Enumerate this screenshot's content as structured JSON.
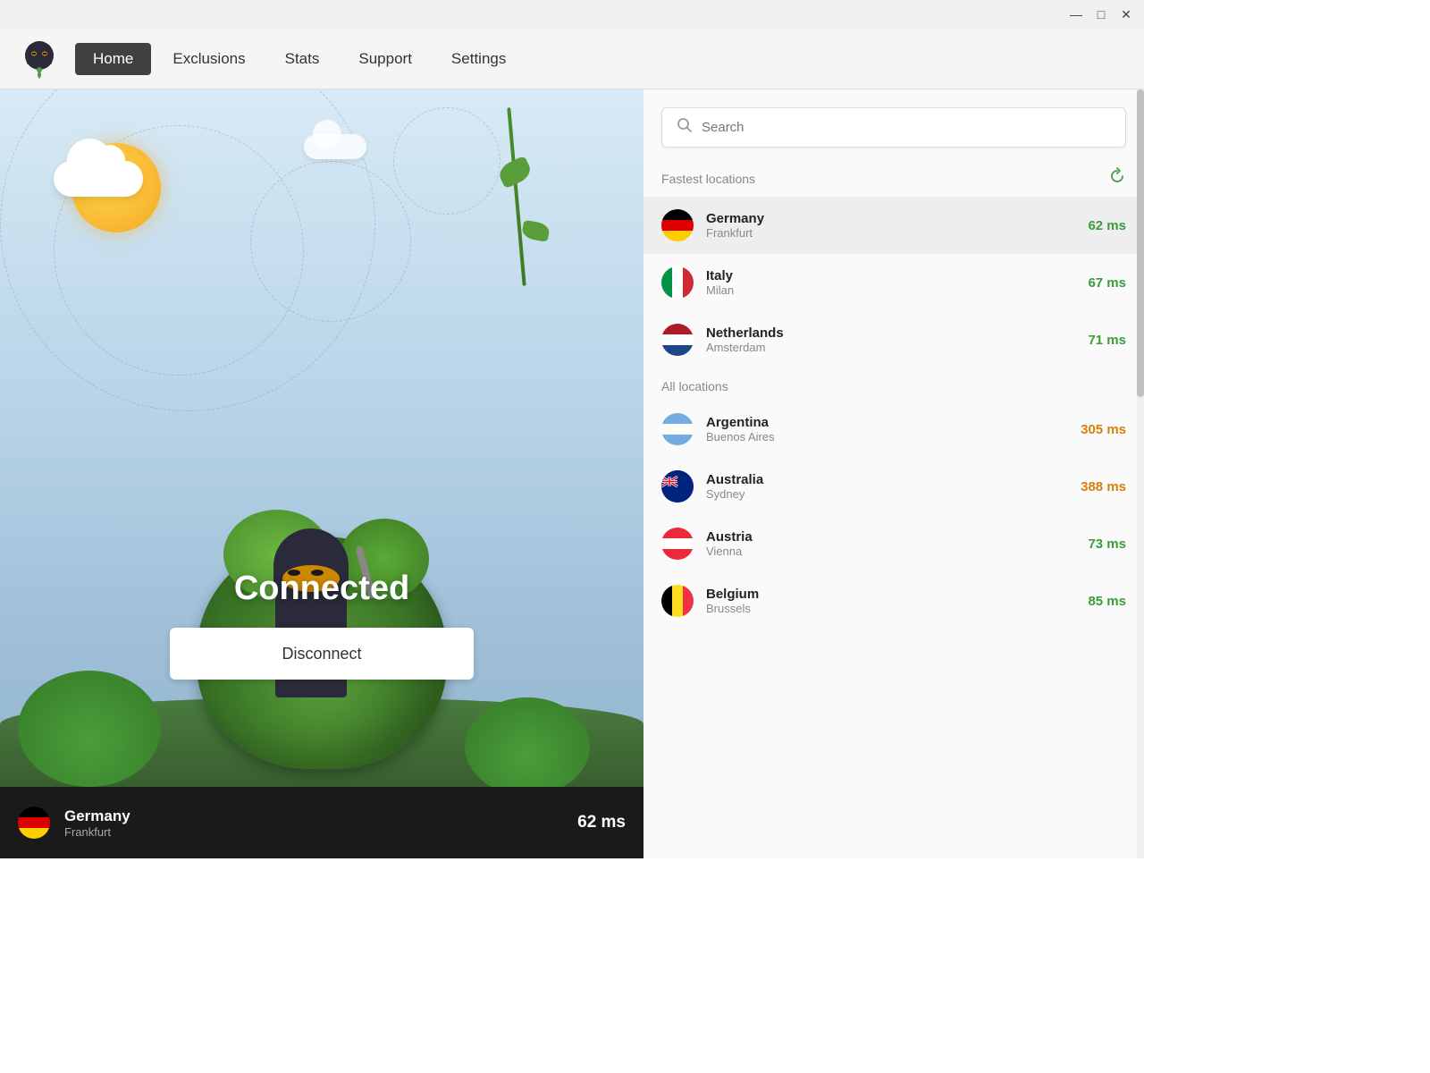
{
  "titleBar": {
    "minimize": "—",
    "maximize": "□",
    "close": "✕"
  },
  "nav": {
    "logo_alt": "VPN Ninja Logo",
    "items": [
      {
        "label": "Home",
        "active": true
      },
      {
        "label": "Exclusions",
        "active": false
      },
      {
        "label": "Stats",
        "active": false
      },
      {
        "label": "Support",
        "active": false
      },
      {
        "label": "Settings",
        "active": false
      }
    ]
  },
  "leftPanel": {
    "status": "Connected",
    "disconnectBtn": "Disconnect",
    "statusBar": {
      "country": "Germany",
      "city": "Frankfurt",
      "latency": "62 ms"
    }
  },
  "rightPanel": {
    "search": {
      "placeholder": "Search"
    },
    "fastestLocations": {
      "sectionTitle": "Fastest locations",
      "items": [
        {
          "country": "Germany",
          "city": "Frankfurt",
          "latency": "62 ms",
          "latencyClass": "green",
          "flagClass": "flag-de",
          "selected": true
        },
        {
          "country": "Italy",
          "city": "Milan",
          "latency": "67 ms",
          "latencyClass": "green",
          "flagClass": "flag-it",
          "selected": false
        },
        {
          "country": "Netherlands",
          "city": "Amsterdam",
          "latency": "71 ms",
          "latencyClass": "green",
          "flagClass": "flag-nl",
          "selected": false
        }
      ]
    },
    "allLocations": {
      "sectionTitle": "All locations",
      "items": [
        {
          "country": "Argentina",
          "city": "Buenos Aires",
          "latency": "305 ms",
          "latencyClass": "orange",
          "flagClass": "flag-ar",
          "selected": false
        },
        {
          "country": "Australia",
          "city": "Sydney",
          "latency": "388 ms",
          "latencyClass": "orange",
          "flagClass": "flag-au",
          "selected": false
        },
        {
          "country": "Austria",
          "city": "Vienna",
          "latency": "73 ms",
          "latencyClass": "green",
          "flagClass": "flag-at",
          "selected": false
        },
        {
          "country": "Belgium",
          "city": "Brussels",
          "latency": "85 ms",
          "latencyClass": "green",
          "flagClass": "flag-be",
          "selected": false
        }
      ]
    }
  }
}
